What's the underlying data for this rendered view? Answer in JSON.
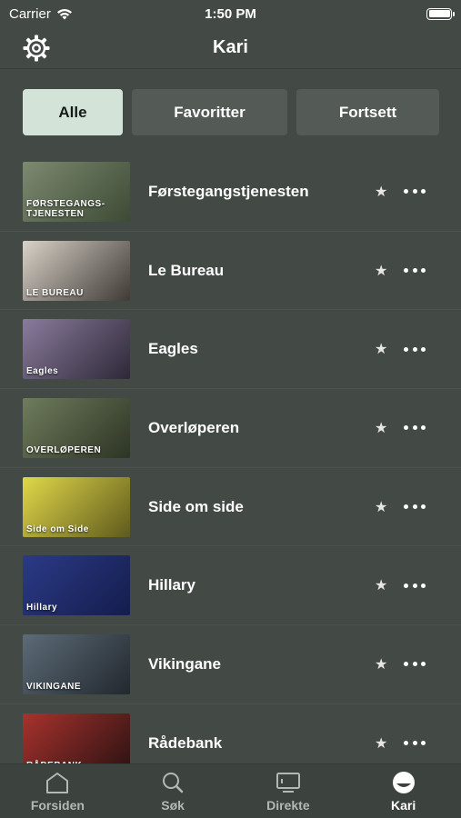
{
  "status": {
    "carrier": "Carrier",
    "time": "1:50 PM"
  },
  "header": {
    "title": "Kari"
  },
  "filters": [
    {
      "label": "Alle",
      "active": true
    },
    {
      "label": "Favoritter",
      "active": false
    },
    {
      "label": "Fortsett",
      "active": false
    }
  ],
  "items": [
    {
      "title": "Førstegangstjenesten",
      "thumb_text": "FØRSTEGANGS-TJENESTEN",
      "thumb_colors": [
        "#7d8a70",
        "#3d4a35"
      ]
    },
    {
      "title": "Le Bureau",
      "thumb_text": "LE BUREAU",
      "thumb_colors": [
        "#d8d2c8",
        "#3f3a35"
      ]
    },
    {
      "title": "Eagles",
      "thumb_text": "Eagles",
      "thumb_colors": [
        "#8a7b9c",
        "#2e2838"
      ]
    },
    {
      "title": "Overløperen",
      "thumb_text": "OVERLØPEREN",
      "thumb_colors": [
        "#6f7c5c",
        "#2d3424"
      ]
    },
    {
      "title": "Side om side",
      "thumb_text": "Side om Side",
      "thumb_colors": [
        "#e0d848",
        "#5f5a1e"
      ]
    },
    {
      "title": "Hillary",
      "thumb_text": "Hillary",
      "thumb_colors": [
        "#2b3a86",
        "#141d4d"
      ]
    },
    {
      "title": "Vikingane",
      "thumb_text": "VIKINGANE",
      "thumb_colors": [
        "#5c6b77",
        "#22282e"
      ]
    },
    {
      "title": "Rådebank",
      "thumb_text": "RÅDEBANK",
      "thumb_colors": [
        "#a8322e",
        "#2a1211"
      ]
    }
  ],
  "tabs": [
    {
      "label": "Forsiden",
      "icon": "home-icon",
      "active": false
    },
    {
      "label": "Søk",
      "icon": "search-icon",
      "active": false
    },
    {
      "label": "Direkte",
      "icon": "tv-icon",
      "active": false
    },
    {
      "label": "Kari",
      "icon": "profile-icon",
      "active": true
    }
  ]
}
